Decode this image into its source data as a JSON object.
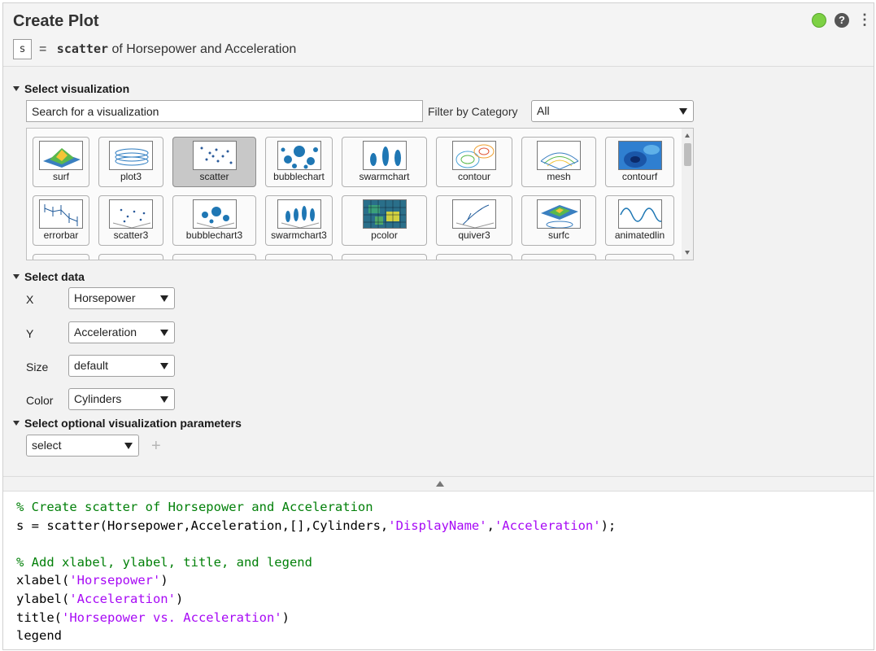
{
  "header": {
    "title": "Create Plot",
    "output_var": "s",
    "equals": "=",
    "function_name": "scatter",
    "summary_rest": "of Horsepower and Acceleration",
    "status_color": "#7dd144"
  },
  "visualization": {
    "section_label": "Select visualization",
    "search_placeholder": "Search for a visualization",
    "filter_label": "Filter by Category",
    "filter_value": "All",
    "tiles": [
      {
        "label": "surf",
        "icon": "surf-icon"
      },
      {
        "label": "plot3",
        "icon": "plot3-icon"
      },
      {
        "label": "scatter",
        "icon": "scatter-icon",
        "selected": true
      },
      {
        "label": "bubblechart",
        "icon": "bubblechart-icon"
      },
      {
        "label": "swarmchart",
        "icon": "swarmchart-icon"
      },
      {
        "label": "contour",
        "icon": "contour-icon"
      },
      {
        "label": "mesh",
        "icon": "mesh-icon"
      },
      {
        "label": "contourf",
        "icon": "contourf-icon"
      },
      {
        "label": "errorbar",
        "icon": "errorbar-icon"
      },
      {
        "label": "scatter3",
        "icon": "scatter3-icon"
      },
      {
        "label": "bubblechart3",
        "icon": "bubblechart3-icon"
      },
      {
        "label": "swarmchart3",
        "icon": "swarmchart3-icon"
      },
      {
        "label": "pcolor",
        "icon": "pcolor-icon"
      },
      {
        "label": "quiver3",
        "icon": "quiver3-icon"
      },
      {
        "label": "surfc",
        "icon": "surfc-icon"
      },
      {
        "label": "animatedlin",
        "icon": "animatedline-icon"
      }
    ]
  },
  "data_section": {
    "section_label": "Select data",
    "fields": [
      {
        "label": "X",
        "value": "Horsepower"
      },
      {
        "label": "Y",
        "value": "Acceleration"
      },
      {
        "label": "Size",
        "value": "default"
      },
      {
        "label": "Color",
        "value": "Cylinders"
      }
    ]
  },
  "optional": {
    "section_label": "Select optional visualization parameters",
    "select_value": "select",
    "add_icon": "plus-icon"
  },
  "code": {
    "line1": "% Create scatter of Horsepower and Acceleration",
    "line2_pre": "s = scatter(Horsepower,Acceleration,[],Cylinders,",
    "line2_str1": "'DisplayName'",
    "line2_comma": ",",
    "line2_str2": "'Acceleration'",
    "line2_post": ");",
    "line4": "% Add xlabel, ylabel, title, and legend",
    "line5_pre": "xlabel(",
    "line5_str": "'Horsepower'",
    "line5_post": ")",
    "line6_pre": "ylabel(",
    "line6_str": "'Acceleration'",
    "line6_post": ")",
    "line7_pre": "title(",
    "line7_str": "'Horsepower vs. Acceleration'",
    "line7_post": ")",
    "line8": "legend",
    "comment_color": "#028009",
    "string_color": "#a709f5"
  }
}
